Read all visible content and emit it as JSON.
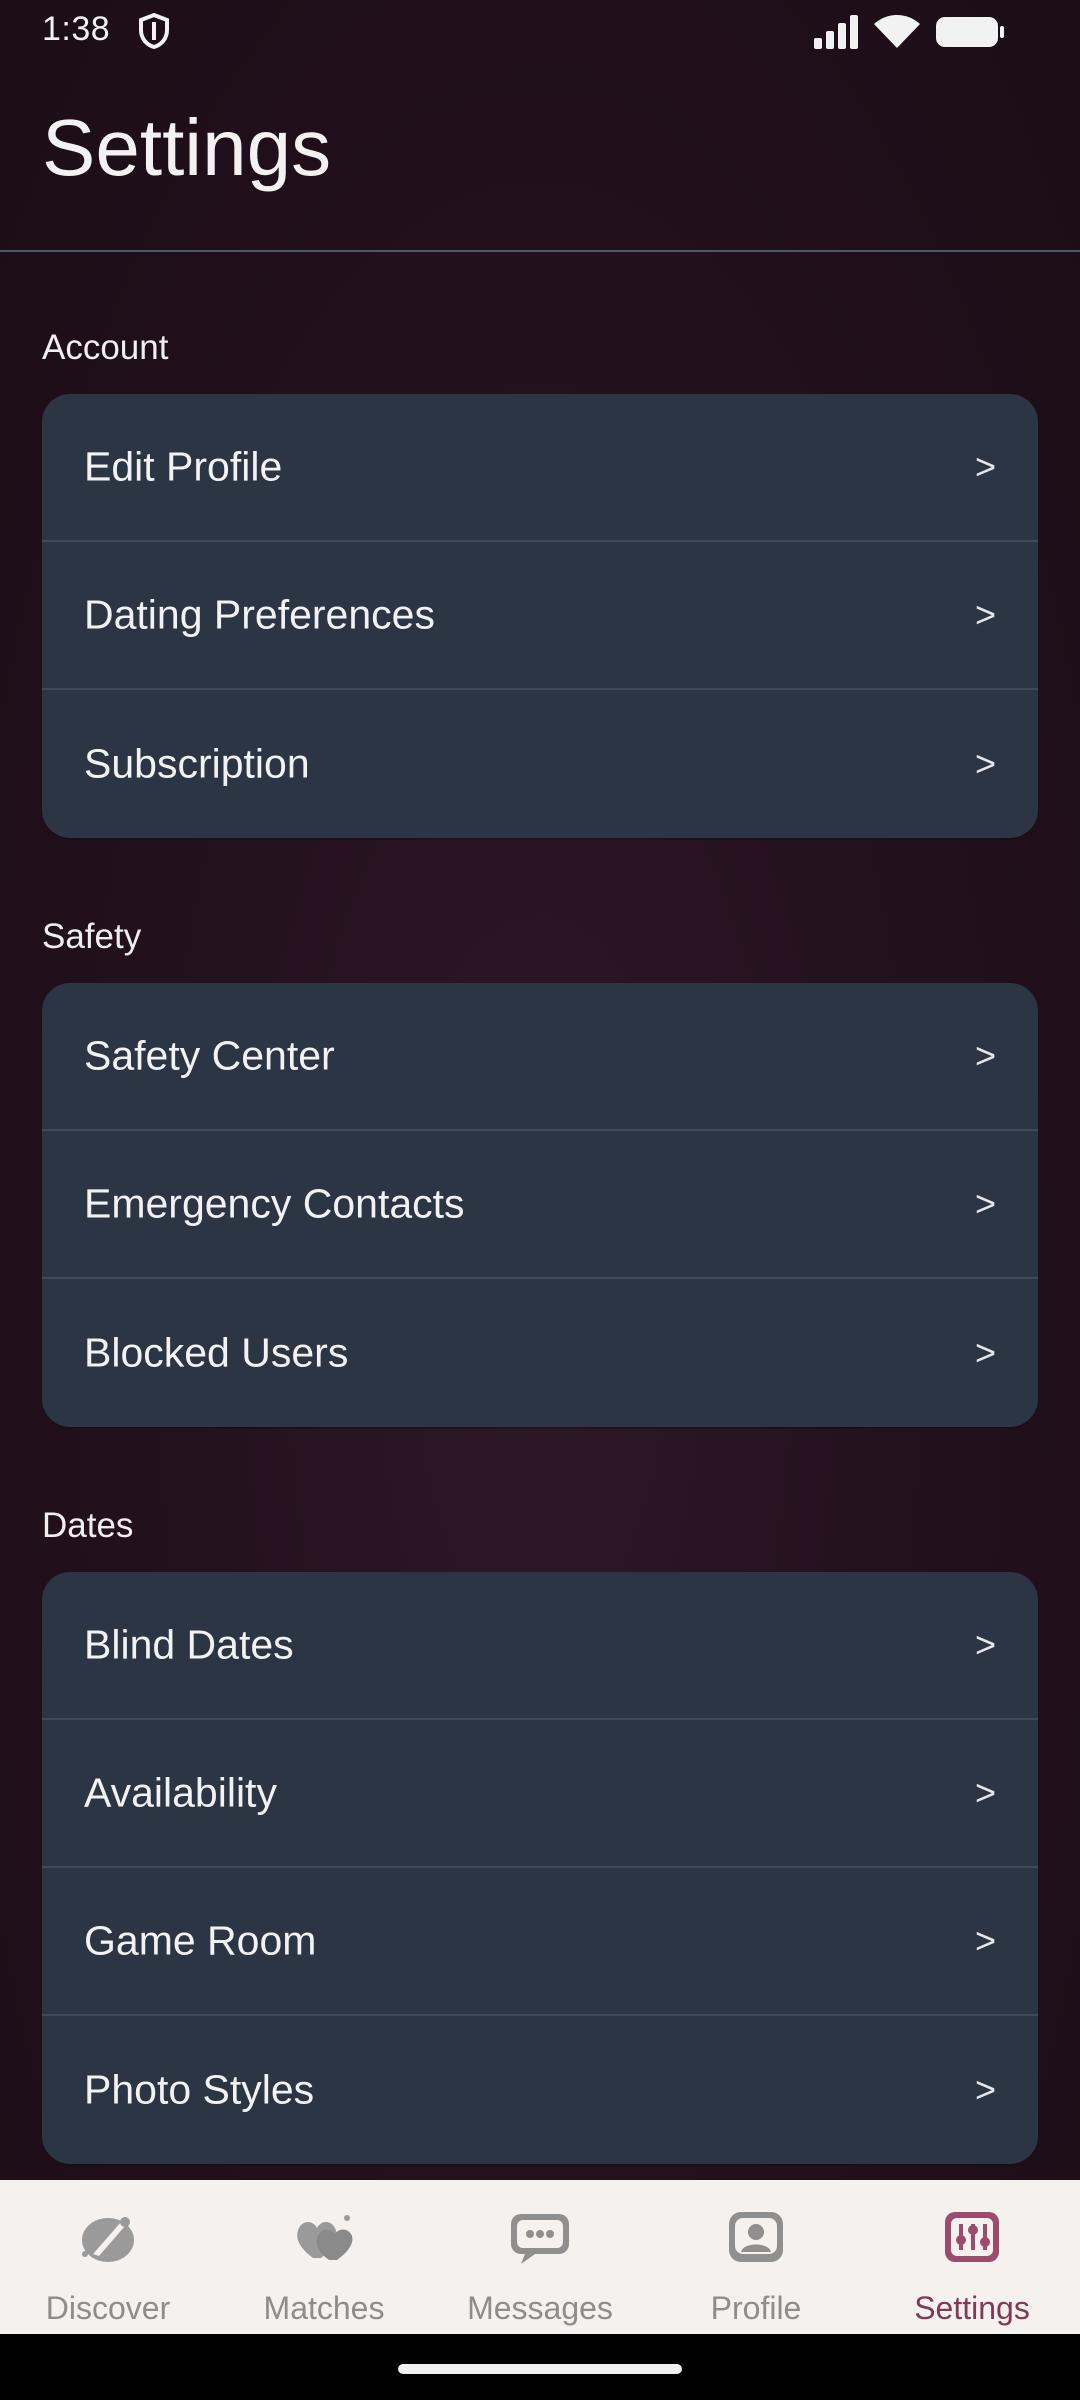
{
  "status_bar": {
    "time": "1:38"
  },
  "header": {
    "title": "Settings"
  },
  "sections": [
    {
      "label": "Account",
      "items": [
        {
          "label": "Edit Profile",
          "chevron": ">"
        },
        {
          "label": "Dating Preferences",
          "chevron": ">"
        },
        {
          "label": "Subscription",
          "chevron": ">"
        }
      ]
    },
    {
      "label": "Safety",
      "items": [
        {
          "label": "Safety Center",
          "chevron": ">"
        },
        {
          "label": "Emergency Contacts",
          "chevron": ">"
        },
        {
          "label": "Blocked Users",
          "chevron": ">"
        }
      ]
    },
    {
      "label": "Dates",
      "items": [
        {
          "label": "Blind Dates",
          "chevron": ">"
        },
        {
          "label": "Availability",
          "chevron": ">"
        },
        {
          "label": "Game Room",
          "chevron": ">"
        },
        {
          "label": "Photo Styles",
          "chevron": ">"
        }
      ]
    }
  ],
  "bottom_nav": {
    "items": [
      {
        "label": "Discover",
        "icon": "discover-icon",
        "active": false
      },
      {
        "label": "Matches",
        "icon": "matches-icon",
        "active": false
      },
      {
        "label": "Messages",
        "icon": "messages-icon",
        "active": false
      },
      {
        "label": "Profile",
        "icon": "profile-icon",
        "active": false
      },
      {
        "label": "Settings",
        "icon": "settings-icon",
        "active": true
      }
    ],
    "active_color": "#7e3a58",
    "inactive_color": "#8d8d8d"
  },
  "colors": {
    "card_background": "#2b3544",
    "page_background": "#24111e"
  }
}
